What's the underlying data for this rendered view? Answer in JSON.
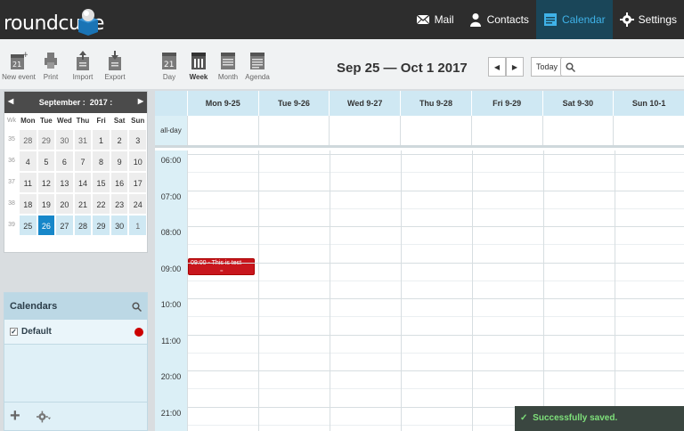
{
  "app": {
    "logo_text": "roundcube"
  },
  "topnav": [
    {
      "label": "Mail",
      "icon": "mail-icon"
    },
    {
      "label": "Contacts",
      "icon": "contacts-icon"
    },
    {
      "label": "Calendar",
      "icon": "calendar-icon",
      "active": true
    },
    {
      "label": "Settings",
      "icon": "gear-icon"
    }
  ],
  "toolbar": {
    "new_event": "New event",
    "print": "Print",
    "import": "Import",
    "export": "Export",
    "day": "Day",
    "week": "Week",
    "month": "Month",
    "agenda": "Agenda",
    "new_event_date": "21",
    "day_date": "21"
  },
  "range_title": "Sep 25 — Oct 1 2017",
  "nav": {
    "prev": "◀",
    "next": "▶",
    "today": "Today"
  },
  "search": {
    "placeholder": ""
  },
  "minical": {
    "month": "September",
    "year": "2017",
    "prev": "◀",
    "next": "▶",
    "wk_label": "Wk",
    "dow": [
      "Mon",
      "Tue",
      "Wed",
      "Thu",
      "Fri",
      "Sat",
      "Sun"
    ],
    "weeks": [
      {
        "wk": "35",
        "days": [
          "28",
          "29",
          "30",
          "31",
          "1",
          "2",
          "3"
        ]
      },
      {
        "wk": "36",
        "days": [
          "4",
          "5",
          "6",
          "7",
          "8",
          "9",
          "10"
        ]
      },
      {
        "wk": "37",
        "days": [
          "11",
          "12",
          "13",
          "14",
          "15",
          "16",
          "17"
        ]
      },
      {
        "wk": "38",
        "days": [
          "18",
          "19",
          "20",
          "21",
          "22",
          "23",
          "24"
        ]
      },
      {
        "wk": "39",
        "days": [
          "25",
          "26",
          "27",
          "28",
          "29",
          "30",
          "1"
        ]
      }
    ]
  },
  "calendars": {
    "title": "Calendars",
    "items": [
      {
        "label": "Default",
        "checked": true,
        "color": "#cc0000"
      }
    ],
    "add": "+"
  },
  "week": {
    "allday_label": "all-day",
    "columns": [
      "Mon 9-25",
      "Tue 9-26",
      "Wed 9-27",
      "Thu 9-28",
      "Fri 9-29",
      "Sat 9-30",
      "Sun 10-1"
    ],
    "hours": [
      "06:00",
      "07:00",
      "08:00",
      "09:00",
      "10:00",
      "11:00",
      "20:00",
      "21:00"
    ]
  },
  "event": {
    "title": "09:00 - This is test",
    "handle": "="
  },
  "notification": {
    "check": "✓",
    "text": "Successfully saved."
  },
  "colors": {
    "accent": "#1787c9",
    "event": "#c8161d",
    "topbar": "#2d2d2d"
  }
}
